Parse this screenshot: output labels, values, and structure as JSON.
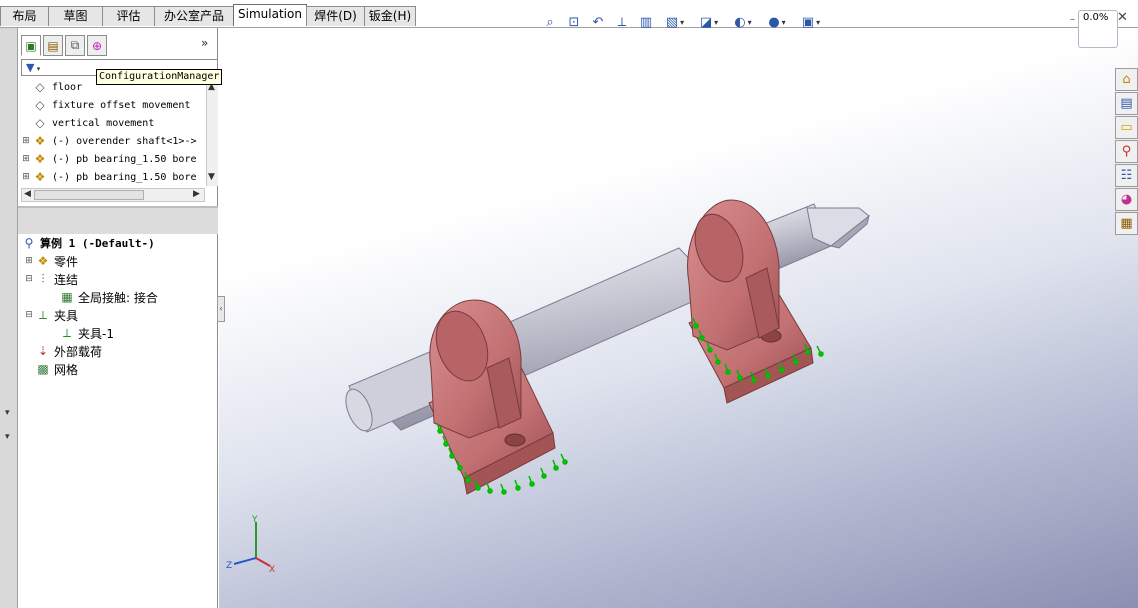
{
  "tabs": [
    {
      "label": "布局",
      "active": false
    },
    {
      "label": "草图",
      "active": false
    },
    {
      "label": "评估",
      "active": false
    },
    {
      "label": "办公室产品",
      "active": false
    },
    {
      "label": "Simulation",
      "active": true
    },
    {
      "label": "焊件(D)",
      "active": false
    },
    {
      "label": "钣金(H)",
      "active": false
    }
  ],
  "hud_toolbar": {
    "icons": [
      "zoom-to-fit-icon",
      "zoom-to-area-icon",
      "previous-view-icon",
      "section-view-icon",
      "dynamic-annotation-icon",
      "view-orientation-icon",
      "display-style-icon",
      "hide-show-icon",
      "edit-appearance-icon",
      "apply-scene-icon"
    ]
  },
  "manager_tabs": [
    "featuremanager-icon",
    "propertymanager-icon",
    "configurationmanager-icon",
    "dimxpert-icon"
  ],
  "tooltip": "ConfigurationManager",
  "feature_tree": {
    "rows": [
      {
        "label": "floor",
        "icon": "plane-icon",
        "expandable": false
      },
      {
        "label": "fixture offset movement",
        "icon": "plane-icon",
        "expandable": false
      },
      {
        "label": "vertical movement",
        "icon": "plane-icon",
        "expandable": false
      },
      {
        "label": "(-) overender shaft<1>->",
        "icon": "part-icon",
        "expandable": true
      },
      {
        "label": "(-) pb bearing_1.50 bore",
        "icon": "part-icon",
        "expandable": true
      },
      {
        "label": "(-) pb bearing_1.50 bore",
        "icon": "part-icon",
        "expandable": true
      }
    ]
  },
  "study_tree": {
    "title": "算例 1 (-Default-)",
    "items": [
      {
        "label": "零件",
        "icon": "parts-icon",
        "indent": 1,
        "expander": "+"
      },
      {
        "label": "连结",
        "icon": "connections-icon",
        "indent": 1,
        "expander": "-"
      },
      {
        "label": "全局接触: 接合",
        "icon": "global-contact-icon",
        "indent": 2,
        "expander": ""
      },
      {
        "label": "夹具",
        "icon": "fixtures-icon",
        "indent": 1,
        "expander": "-"
      },
      {
        "label": "夹具-1",
        "icon": "fixture-icon",
        "indent": 2,
        "expander": ""
      },
      {
        "label": "外部载荷",
        "icon": "external-loads-icon",
        "indent": 1,
        "expander": ""
      },
      {
        "label": "网格",
        "icon": "mesh-icon",
        "indent": 1,
        "expander": ""
      }
    ]
  },
  "task_pane_icons": [
    "home-icon",
    "design-library-icon",
    "file-explorer-icon",
    "search-icon",
    "view-palette-icon",
    "appearances-icon",
    "custom-properties-icon"
  ],
  "status": {
    "progress_text": "0.0%"
  },
  "triad": {
    "x": "X",
    "y": "Y",
    "z": "Z"
  },
  "colors": {
    "bearing": "#c9787a",
    "shaft": "#c8c8d4",
    "fixture_marker": "#00cc00",
    "selected_tab_bg": "#ffffff"
  }
}
